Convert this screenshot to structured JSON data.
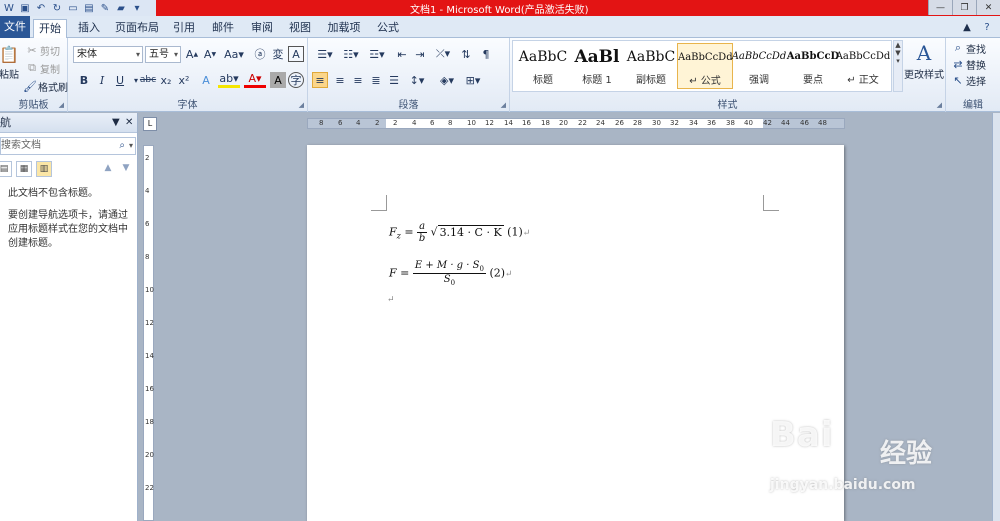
{
  "window": {
    "title": "文档1 - Microsoft Word(产品激活失败)",
    "titlebar_color": "#e31414",
    "controls": [
      "minimize-icon",
      "restore-icon",
      "close-icon"
    ]
  },
  "tabs": {
    "file": "文件",
    "items": [
      "开始",
      "插入",
      "页面布局",
      "引用",
      "邮件",
      "审阅",
      "视图",
      "加载项",
      "公式"
    ],
    "active": "开始"
  },
  "ribbon": {
    "clipboard": {
      "paste": "粘贴",
      "cut": "剪切",
      "copy": "复制",
      "format_painter": "格式刷",
      "label": "剪贴板"
    },
    "font": {
      "name": "宋体",
      "size": "五号",
      "label": "字体"
    },
    "paragraph": {
      "label": "段落"
    },
    "styles": {
      "label": "样式",
      "items": [
        {
          "sample": "AaBbC",
          "name": "标题"
        },
        {
          "sample": "AaBl",
          "name": "标题 1"
        },
        {
          "sample": "AaBbC",
          "name": "副标题"
        },
        {
          "sample": "AaBbCcDd",
          "name": "↵ 公式"
        },
        {
          "sample": "AaBbCcDd",
          "name": "强调"
        },
        {
          "sample": "AaBbCcD",
          "name": "要点"
        },
        {
          "sample": "AaBbCcDd",
          "name": "↵ 正文"
        }
      ],
      "selected_index": 3,
      "change_styles": "更改样式"
    },
    "editing": {
      "find": "查找",
      "replace": "替换",
      "select": "选择",
      "label": "编辑"
    }
  },
  "nav": {
    "title": "航",
    "search_placeholder": "搜索文档",
    "no_headings": "此文档不包含标题。",
    "hint": "要创建导航选项卡，请通过应用标题样式在您的文档中创建标题。"
  },
  "ruler": {
    "h_ticks": [
      "8",
      "6",
      "4",
      "2",
      "2",
      "4",
      "6",
      "8",
      "10",
      "12",
      "14",
      "16",
      "18",
      "20",
      "22",
      "24",
      "26",
      "28",
      "30",
      "32",
      "34",
      "36",
      "38",
      "40",
      "42",
      "44",
      "46",
      "48"
    ],
    "v_ticks": [
      "2",
      "4",
      "6",
      "8",
      "10",
      "12",
      "14",
      "16",
      "18",
      "20",
      "22"
    ]
  },
  "document": {
    "eq1": {
      "lhs": "F",
      "lhs_sub": "z",
      "num": "a",
      "den": "b",
      "radicand": "3.14 · C · K",
      "label": "(1)"
    },
    "eq2": {
      "lhs": "F",
      "num": "E + M · g · S",
      "num_sub": "0",
      "den": "S",
      "den_sub": "0",
      "label": "(2)"
    },
    "para_mark": "↵"
  },
  "watermark": {
    "brand": "Bai",
    "brand2": "经验",
    "url": "jingyan.baidu.com"
  }
}
